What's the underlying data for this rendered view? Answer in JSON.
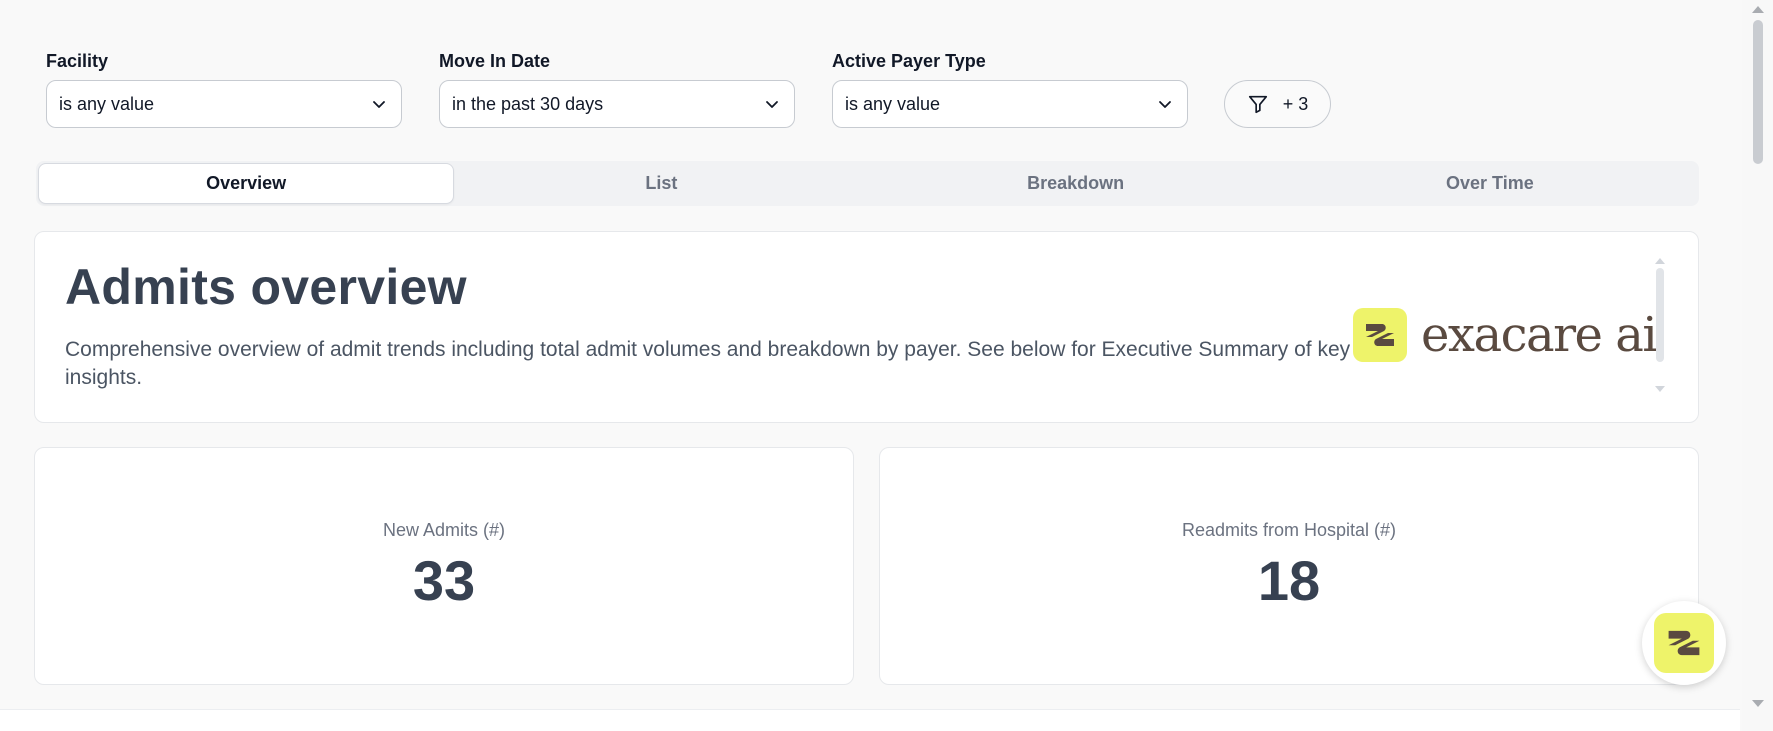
{
  "filters": [
    {
      "label": "Facility",
      "value": "is any value"
    },
    {
      "label": "Move In Date",
      "value": "in the past 30 days"
    },
    {
      "label": "Active Payer Type",
      "value": "is any value"
    }
  ],
  "more_filters": {
    "label": "+ 3",
    "icon": "filter-icon"
  },
  "tabs": [
    {
      "label": "Overview",
      "active": true
    },
    {
      "label": "List",
      "active": false
    },
    {
      "label": "Breakdown",
      "active": false
    },
    {
      "label": "Over Time",
      "active": false
    }
  ],
  "overview": {
    "title": "Admits overview",
    "description": "Comprehensive overview of admit trends including total admit volumes and breakdown by payer. See below for Executive Summary of key insights.",
    "brand": "exacare ai"
  },
  "kpis": [
    {
      "label": "New Admits (#)",
      "value": "33"
    },
    {
      "label": "Readmits from Hospital (#)",
      "value": "18"
    }
  ],
  "colors": {
    "brand_yellow": "#eef36a",
    "brand_brown": "#5a4a40",
    "background": "#f9f9f9"
  }
}
